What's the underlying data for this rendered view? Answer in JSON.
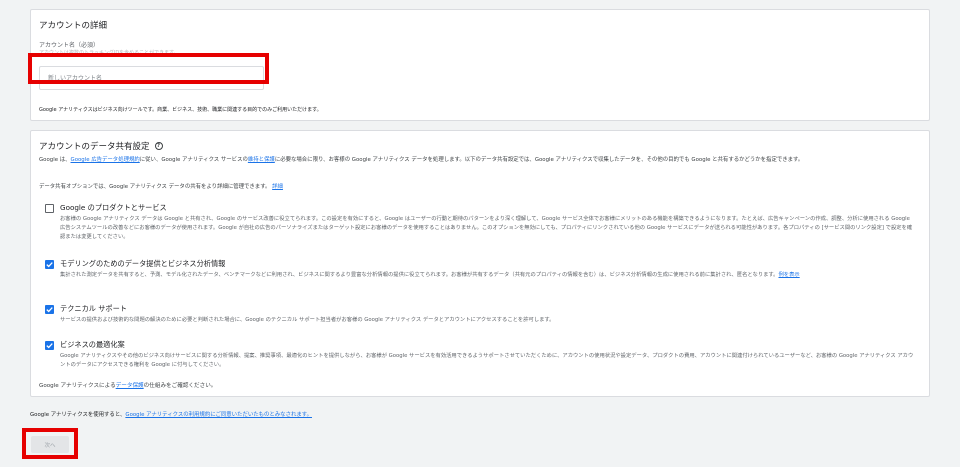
{
  "account_details": {
    "title": "アカウントの詳細",
    "name_label": "アカウント名（必須）",
    "name_hint": "アカウントは複数のトラッキングIDを含めることができます。",
    "name_placeholder": "新しいアカウント名",
    "usage_note": "Google アナリティクスはビジネス向けツールです。商業、ビジネス、技術、職業に関連する目的でのみご利用いただけます。"
  },
  "data_sharing": {
    "title": "アカウントのデータ共有設定",
    "intro_prefix": "Google は、",
    "intro_link1": "Google 広告データ処理規約",
    "intro_mid": "に従い、Google アナリティクス サービスの",
    "intro_link2": "維持と保護",
    "intro_suffix": "に必要な場合に限り、お客様の Google アナリティクス データを処理します。以下のデータ共有設定では、Google アナリティクスで収集したデータを、その他の目的でも Google と共有するかどうかを指定できます。",
    "intro2_text": "データ共有オプションでは、Google アナリティクス データの共有をより詳細に管理できます。",
    "intro2_link": "詳細",
    "options": [
      {
        "title": "Google のプロダクトとサービス",
        "checked": false,
        "desc": "お客様の Google アナリティクス データは Google と共有され、Google のサービス改善に役立てられます。この設定を有効にすると、Google はユーザーの行動と期待のパターンをより深く理解して、Google サービス全体でお客様にメリットのある機能を構築できるようになります。たとえば、広告キャンペーンの作成、調整、分析に使用される Google 広告システムツールの改善などにお客様のデータが使用されます。Google が自社の広告のパーソナライズまたはターゲット設定にお客様のデータを使用することはありません。このオプションを無効にしても、プロパティにリンクされている他の Google サービスにデータが送られる可能性があります。各プロパティの [サービス間のリンク設定] で設定を確認または変更してください。"
      },
      {
        "title": "モデリングのためのデータ提供とビジネス分析情報",
        "checked": true,
        "desc": "集計された測定データを共有すると、予測、モデル化されたデータ、ベンチマークなどに利用され、ビジネスに関するより豊富な分析情報の提供に役立てられます。お客様が共有するデータ（共有元のプロパティの情報を含む）は、ビジネス分析情報の生成に使用される前に集計され、匿名となります。",
        "link": "例を表示"
      },
      {
        "title": "テクニカル サポート",
        "checked": true,
        "desc": "サービスの提供および技術的な問題の解決のために必要と判断された場合に、Google のテクニカル サポート担当者がお客様の Google アナリティクス データとアカウントにアクセスすることを許可します。"
      },
      {
        "title": "ビジネスの最適化案",
        "checked": true,
        "desc": "Google アナリティクスやその他のビジネス向けサービスに関する分析情報、提案、推奨事項、最適化のヒントを提供しながら、お客様が Google サービスを有効活用できるようサポートさせていただくために、アカウントの使用状況や設定データ、プロダクトの費用、アカウントに関連付けられているユーザーなど、お客様の Google アナリティクス アカウントのデータにアクセスできる権利を Google に付与してください。"
      }
    ],
    "footer_prefix": "Google アナリティクスによる",
    "footer_link": "データ保護",
    "footer_suffix": "の仕組みをご確認ください。"
  },
  "terms": {
    "prefix": "Google アナリティクスを使用すると、",
    "link": "Google アナリティクスの利用規約にご同意いただいたものとみなされます。"
  },
  "next_button": "次へ",
  "colors": {
    "highlight": "#e60000",
    "link": "#1a73e8",
    "checkbox": "#1a73e8"
  }
}
